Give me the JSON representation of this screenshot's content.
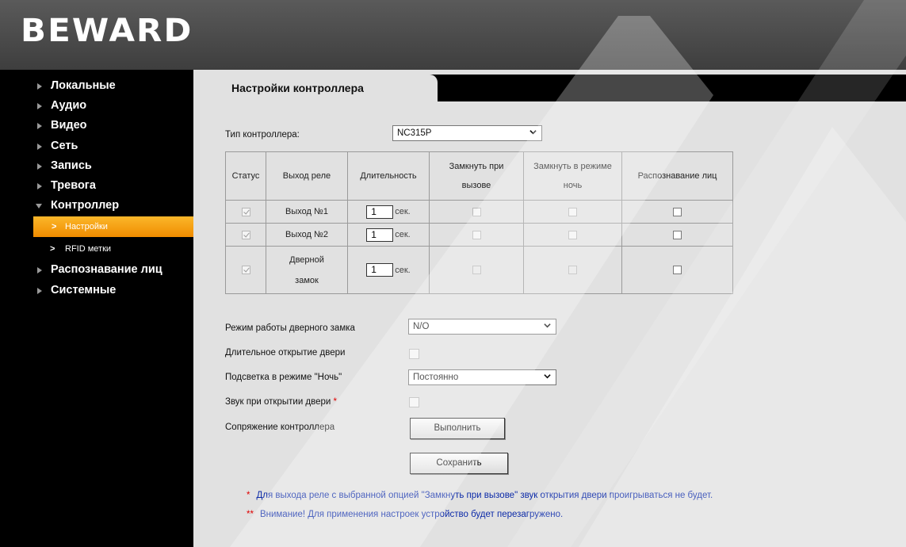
{
  "brand": {
    "logo": "BEWARD"
  },
  "sidebar": {
    "items": [
      {
        "label": "Локальные"
      },
      {
        "label": "Аудио"
      },
      {
        "label": "Видео"
      },
      {
        "label": "Сеть"
      },
      {
        "label": "Запись"
      },
      {
        "label": "Тревога"
      },
      {
        "label": "Контроллер",
        "expanded": true,
        "children": [
          {
            "label": "Настройки",
            "active": true
          },
          {
            "label": "RFID метки"
          }
        ]
      },
      {
        "label": "Распознавание лиц"
      },
      {
        "label": "Системные"
      }
    ],
    "active_color": "#f5a01a"
  },
  "tab": {
    "title": "Настройки контроллера"
  },
  "controller_type": {
    "label": "Тип контроллера:",
    "value": "NC315P"
  },
  "relay_table": {
    "headers": {
      "status": "Статус",
      "relay": "Выход реле",
      "duration": "Длительность",
      "close_on_call": "Замкнуть при вызове",
      "close_night": "Замкнуть в режиме ночь",
      "face": "Распознавание лиц"
    },
    "rows": [
      {
        "status": true,
        "relay": "Выход №1",
        "duration": "1",
        "unit": "сек.",
        "close_on_call": false,
        "close_night": false,
        "face": false
      },
      {
        "status": true,
        "relay": "Выход №2",
        "duration": "1",
        "unit": "сек.",
        "close_on_call": false,
        "close_night": false,
        "face": false
      },
      {
        "status": true,
        "relay": "Дверной замок",
        "duration": "1",
        "unit": "сек.",
        "close_on_call": false,
        "close_night": false,
        "face": false
      }
    ]
  },
  "settings": {
    "lock_mode": {
      "label": "Режим работы дверного замка",
      "value": "N/O"
    },
    "long_open": {
      "label": "Длительное открытие двери",
      "checked": false
    },
    "night_light": {
      "label": "Подсветка в режиме \"Ночь\"",
      "value": "Постоянно"
    },
    "open_sound": {
      "label": "Звук при открытии двери",
      "star": "*",
      "checked": false
    },
    "pairing": {
      "label": "Сопряжение контроллера",
      "button": "Выполнить"
    }
  },
  "save_button": "Сохранить",
  "notes": [
    {
      "star": "*",
      "text": "Для выхода реле с выбранной опцией \"Замкнуть при вызове\" звук открытия двери проигрываться не будет."
    },
    {
      "star": "**",
      "text": "Внимание! Для применения настроек устройство будет перезагружено."
    }
  ],
  "colors": {
    "header": "#4a4a4a",
    "sidebar": "#000000",
    "content": "#e1e1e1",
    "note": "#0c2aa8",
    "required": "#e00000"
  }
}
